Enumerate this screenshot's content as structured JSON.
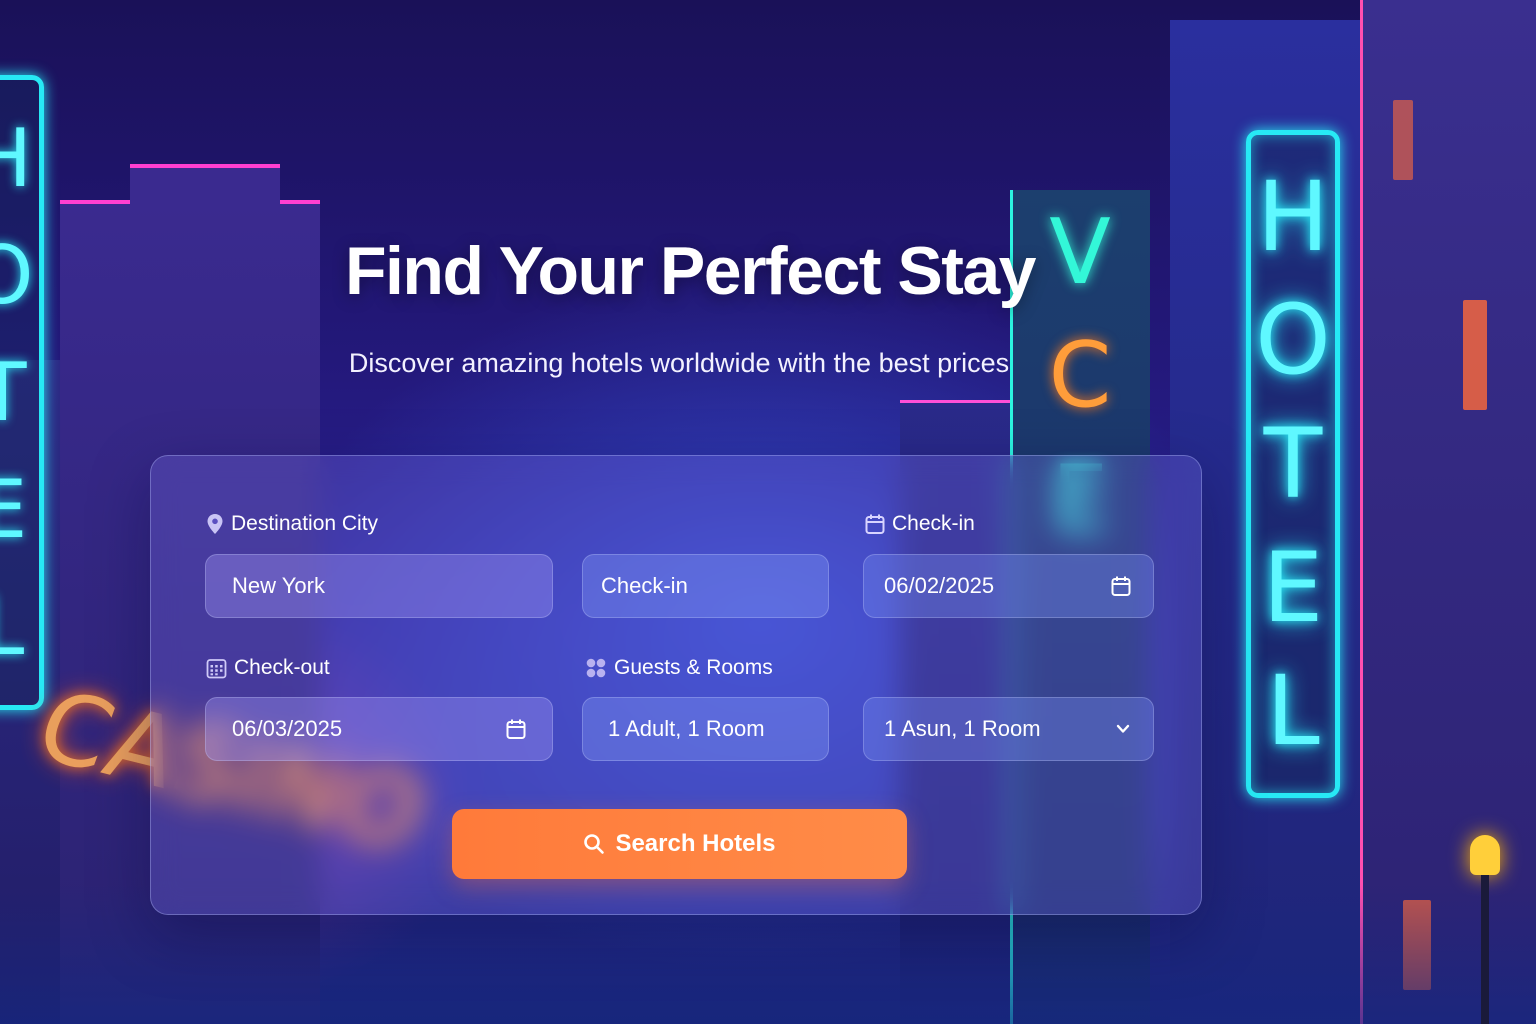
{
  "hero": {
    "title": "Find Your Perfect Stay",
    "subtitle": "Discover amazing hotels worldwide with the best prices"
  },
  "scene": {
    "signs": {
      "hotel_right": [
        "H",
        "O",
        "T",
        "E",
        "L"
      ],
      "hotel_left": [
        "H",
        "O",
        "T",
        "E",
        "L"
      ],
      "vertical_sign": [
        "V",
        "C",
        "E"
      ],
      "casino": "CASINO"
    }
  },
  "form": {
    "destination": {
      "label": "Destination City",
      "value": "New York",
      "icon": "map-pin-icon"
    },
    "checkin_mid": {
      "value": "Check-in"
    },
    "checkin": {
      "label": "Check-in",
      "value": "06/02/2025",
      "icon": "calendar-icon"
    },
    "checkout": {
      "label": "Check-out",
      "value": "06/03/2025",
      "icon": "calendar-grid-icon"
    },
    "guests": {
      "label": "Guests & Rooms",
      "value": "1 Adult, 1 Room",
      "icon": "guests-icon"
    },
    "guests_select": {
      "value": "1 Asun, 1 Room",
      "icon": "chevron-down-icon"
    }
  },
  "search_button": {
    "label": "Search Hotels",
    "icon": "search-icon"
  },
  "colors": {
    "accent": "#ff7a3a",
    "neon_cyan": "#27e9f5",
    "neon_orange": "#ff9d3a",
    "background": "#1a1160"
  }
}
